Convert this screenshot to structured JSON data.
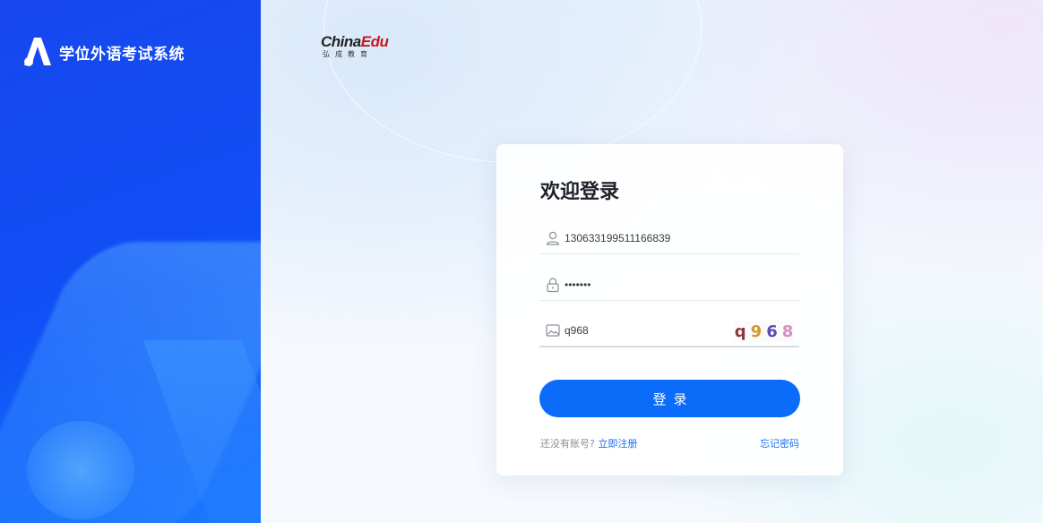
{
  "app": {
    "title": "学位外语考试系统",
    "brand_main_a": "China",
    "brand_main_b": "Edu",
    "brand_sub": "弘成教育"
  },
  "login": {
    "heading": "欢迎登录",
    "username_value": "130633199511166839",
    "password_value": "•••••••",
    "captcha_value": "q968",
    "captcha_image_chars": [
      "q",
      "9",
      "6",
      "8"
    ],
    "submit_label": "登录",
    "no_account_text": "还没有账号?",
    "register_link": "立即注册",
    "forgot_link": "忘记密码"
  },
  "icons": {
    "user": "user-icon",
    "lock": "lock-icon",
    "image": "image-icon",
    "logo": "logo-a-icon"
  },
  "colors": {
    "primary": "#0a6cf8",
    "left_panel": "#1747ee",
    "link": "#1a6ff0"
  }
}
